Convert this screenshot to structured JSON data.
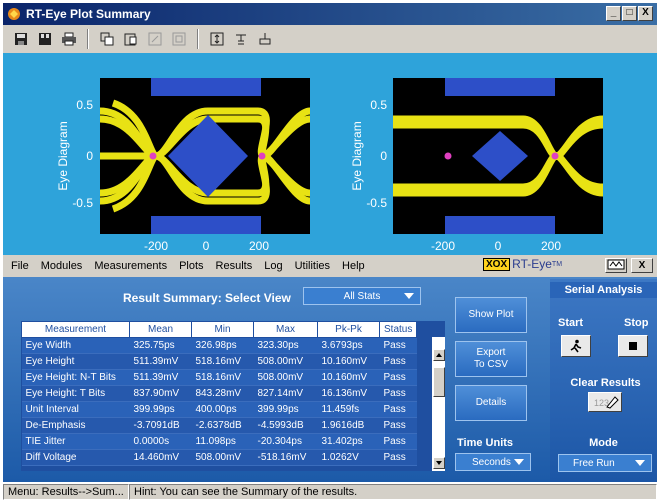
{
  "window": {
    "title": "RT-Eye Plot Summary",
    "controls": [
      "_",
      "□",
      "X"
    ]
  },
  "toolbar": {
    "icons": [
      "save-icon",
      "save-all-icon",
      "print-icon",
      "copy-icon",
      "paste-icon",
      "zoom-icon",
      "zoom-out-icon",
      "fit-icon",
      "marker-icon",
      "cursor-icon"
    ]
  },
  "plots": [
    {
      "ylabel": "Eye Diagram",
      "yticks": [
        "0.5",
        "0",
        "-0.5"
      ],
      "xticks": [
        "-200",
        "0",
        "200"
      ]
    },
    {
      "ylabel": "Eye Diagram",
      "yticks": [
        "0.5",
        "0",
        "-0.5"
      ],
      "xticks": [
        "-200",
        "0",
        "200"
      ]
    }
  ],
  "menu": {
    "items": [
      {
        "label": "File",
        "u": "F"
      },
      {
        "label": "Modules",
        "u": "M"
      },
      {
        "label": "Measurements",
        "u": "e"
      },
      {
        "label": "Plots",
        "u": "P"
      },
      {
        "label": "Results",
        "u": "R"
      },
      {
        "label": "Log",
        "u": "L"
      },
      {
        "label": "Utilities",
        "u": "U"
      },
      {
        "label": "Help",
        "u": "H"
      }
    ],
    "brand_logo": "XOX",
    "brand": "RT-Eye",
    "brand_tm": "TM"
  },
  "results": {
    "title": "Result Summary: Select View",
    "view": "All Stats",
    "columns": [
      "Measurement",
      "Mean",
      "Min",
      "Max",
      "Pk-Pk",
      "Status"
    ],
    "rows": [
      [
        "Eye Width",
        "325.75ps",
        "326.98ps",
        "323.30ps",
        "3.6793ps",
        "Pass"
      ],
      [
        "Eye Height",
        "511.39mV",
        "518.16mV",
        "508.00mV",
        "10.160mV",
        "Pass"
      ],
      [
        "Eye Height: N-T Bits",
        "511.39mV",
        "518.16mV",
        "508.00mV",
        "10.160mV",
        "Pass"
      ],
      [
        "Eye Height: T Bits",
        "837.90mV",
        "843.28mV",
        "827.14mV",
        "16.136mV",
        "Pass"
      ],
      [
        "Unit Interval",
        "399.99ps",
        "400.00ps",
        "399.99ps",
        "11.459fs",
        "Pass"
      ],
      [
        "De-Emphasis",
        "-3.7091dB",
        "-2.6378dB",
        "-4.5993dB",
        "1.9616dB",
        "Pass"
      ],
      [
        "TIE Jitter",
        "0.0000s",
        "11.098ps",
        "-20.304ps",
        "31.402ps",
        "Pass"
      ],
      [
        "Diff Voltage",
        "14.460mV",
        "508.00mV",
        "-518.16mV",
        "1.0262V",
        "Pass"
      ]
    ]
  },
  "side_buttons": {
    "show_plot": "Show Plot",
    "export_line1": "Export",
    "export_line2": "To CSV",
    "details": "Details",
    "time_units_label": "Time Units",
    "time_units_value": "Seconds"
  },
  "serial": {
    "title": "Serial Analysis",
    "start": "Start",
    "stop": "Stop",
    "clear": "Clear Results",
    "clear_icon_text": "123",
    "mode_label": "Mode",
    "mode_value": "Free Run"
  },
  "status": {
    "menu_path": "Menu: Results-->Sum...",
    "hint": "Hint: You can see the Summary of the results."
  },
  "colors": {
    "plot_bg": "#2ea3da",
    "eye_trace": "#f5ef16",
    "mask": "#2d4fc8",
    "marker": "#e040c0"
  }
}
